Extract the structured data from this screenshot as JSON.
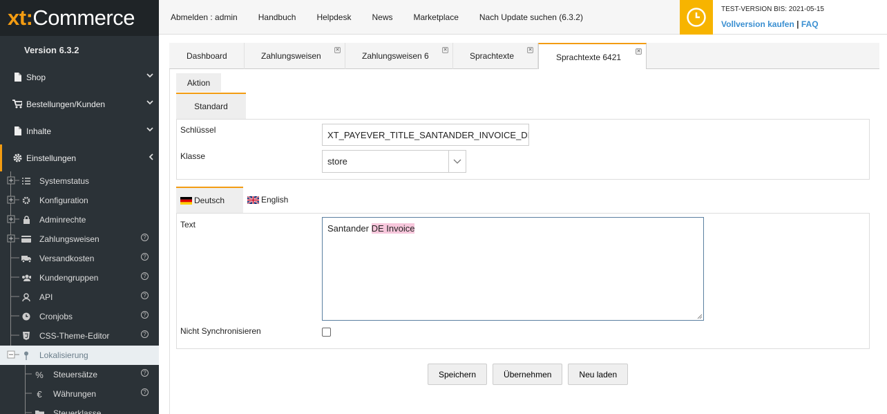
{
  "sidebar": {
    "logo_xt": "xt",
    "logo_colon": ":",
    "logo_commerce": "Commerce",
    "version": "Version 6.3.2",
    "main_items": [
      {
        "label": "Shop",
        "icon": "file-icon"
      },
      {
        "label": "Bestellungen/Kunden",
        "icon": "cart-icon"
      },
      {
        "label": "Inhalte",
        "icon": "file-icon"
      },
      {
        "label": "Einstellungen",
        "icon": "gear-icon"
      }
    ],
    "sub_items": [
      {
        "label": "Systemstatus",
        "icon": "list-icon",
        "help": false
      },
      {
        "label": "Konfiguration",
        "icon": "gear-icon",
        "help": false
      },
      {
        "label": "Adminrechte",
        "icon": "lock-icon",
        "help": false
      },
      {
        "label": "Zahlungsweisen",
        "icon": "card-icon",
        "help": true
      },
      {
        "label": "Versandkosten",
        "icon": "truck-icon",
        "help": true
      },
      {
        "label": "Kundengruppen",
        "icon": "users-icon",
        "help": true
      },
      {
        "label": "API",
        "icon": "api-icon",
        "help": true
      },
      {
        "label": "Cronjobs",
        "icon": "clock-icon",
        "help": true
      },
      {
        "label": "CSS-Theme-Editor",
        "icon": "css-icon",
        "help": true
      },
      {
        "label": "Lokalisierung",
        "icon": "pin-icon",
        "help": false
      }
    ],
    "deep_items": [
      {
        "label": "Steuersätze",
        "icon": "percent-icon"
      },
      {
        "label": "Währungen",
        "icon": "euro-icon"
      },
      {
        "label": "Steuerklasse",
        "icon": "folder-icon"
      }
    ]
  },
  "header": {
    "links": [
      "Abmelden : admin",
      "Handbuch",
      "Helpdesk",
      "News",
      "Marketplace",
      "Nach Update suchen (6.3.2)"
    ],
    "test_version": "TEST-VERSION BIS: 2021-05-15",
    "buy_label": "Vollversion kaufen",
    "separator": "|",
    "faq_label": "FAQ"
  },
  "tabs": [
    {
      "label": "Dashboard",
      "closable": false
    },
    {
      "label": "Zahlungsweisen",
      "closable": true
    },
    {
      "label": "Zahlungsweisen 6",
      "closable": true
    },
    {
      "label": "Sprachtexte",
      "closable": true
    },
    {
      "label": "Sprachtexte 6421",
      "closable": true
    }
  ],
  "form": {
    "action_tab": "Aktion",
    "standard_tab": "Standard",
    "key_label": "Schlüssel",
    "key_value": "XT_PAYEVER_TITLE_SANTANDER_INVOICE_DE",
    "class_label": "Klasse",
    "class_value": "store",
    "lang_tabs": [
      "Deutsch",
      "English"
    ],
    "text_label": "Text",
    "text_plain": "Santander ",
    "text_highlight": "DE Invoice",
    "nosync_label": "Nicht Synchronisieren"
  },
  "buttons": {
    "save": "Speichern",
    "apply": "Übernehmen",
    "reload": "Neu laden"
  },
  "colors": {
    "accent": "#f39c12",
    "sidebar_bg": "#2b3237",
    "link": "#3a8fd1"
  }
}
